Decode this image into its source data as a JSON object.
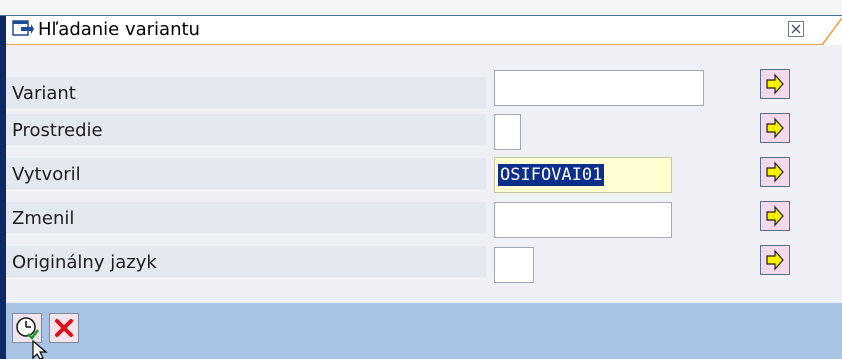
{
  "dialog": {
    "title": "Hľadanie variantu",
    "close_icon": "close-icon",
    "title_icon": "dialog-window-icon"
  },
  "fields": [
    {
      "label": "Variant",
      "value": ""
    },
    {
      "label": "Prostredie",
      "value": ""
    },
    {
      "label": "Vytvoril",
      "value": "OSIFOVAI01"
    },
    {
      "label": "Zmenil",
      "value": ""
    },
    {
      "label": "Originálny jazyk",
      "value": ""
    }
  ],
  "footer": {
    "execute_icon": "execute-icon",
    "cancel_icon": "cancel-icon"
  },
  "colors": {
    "title_accent": "#f0a13b",
    "footer_bg": "#a8c3e4",
    "selection": "#0b2f8a",
    "arrow_yellow": "#f8f000"
  }
}
